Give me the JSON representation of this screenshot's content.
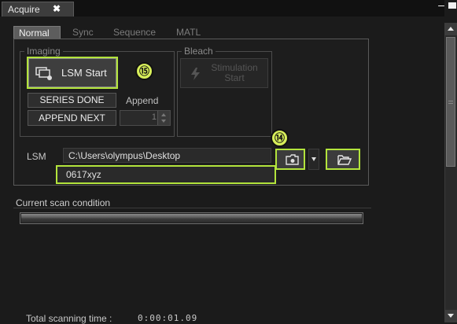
{
  "window": {
    "tab_label": "Acquire",
    "tab_close_glyph": "✖",
    "minimize_glyph": "–"
  },
  "subtabs": [
    {
      "label": "Normal",
      "active": true
    },
    {
      "label": "Sync",
      "active": false
    },
    {
      "label": "Sequence",
      "active": false
    },
    {
      "label": "MATL",
      "active": false
    }
  ],
  "imaging": {
    "group_label": "Imaging",
    "lsm_start_label": "LSM Start",
    "lsm_start_icon": "lsm-start-icon",
    "series_done_label": "SERIES DONE",
    "append_label": "Append",
    "append_next_label": "APPEND NEXT",
    "append_count": "1"
  },
  "bleach": {
    "group_label": "Bleach",
    "stimulation_start_line1": "Stimulation",
    "stimulation_start_line2": "Start",
    "stimulation_icon": "lightning-icon"
  },
  "lsm": {
    "label": "LSM",
    "path": "C:\\Users\\olympus\\Desktop",
    "file_name": "0617xyz",
    "open_folder_icon": "folder-camera-icon",
    "browse_icon": "folder-open-icon"
  },
  "callouts": {
    "c14": "⑭",
    "c15": "⑮"
  },
  "scan": {
    "section_label": "Current scan condition",
    "progress": 1.0,
    "total_time_label": "Total scanning time :",
    "total_time_value": "0:00:01.09"
  },
  "colors": {
    "highlight": "#b3e43c",
    "background": "#1b1b1b"
  }
}
